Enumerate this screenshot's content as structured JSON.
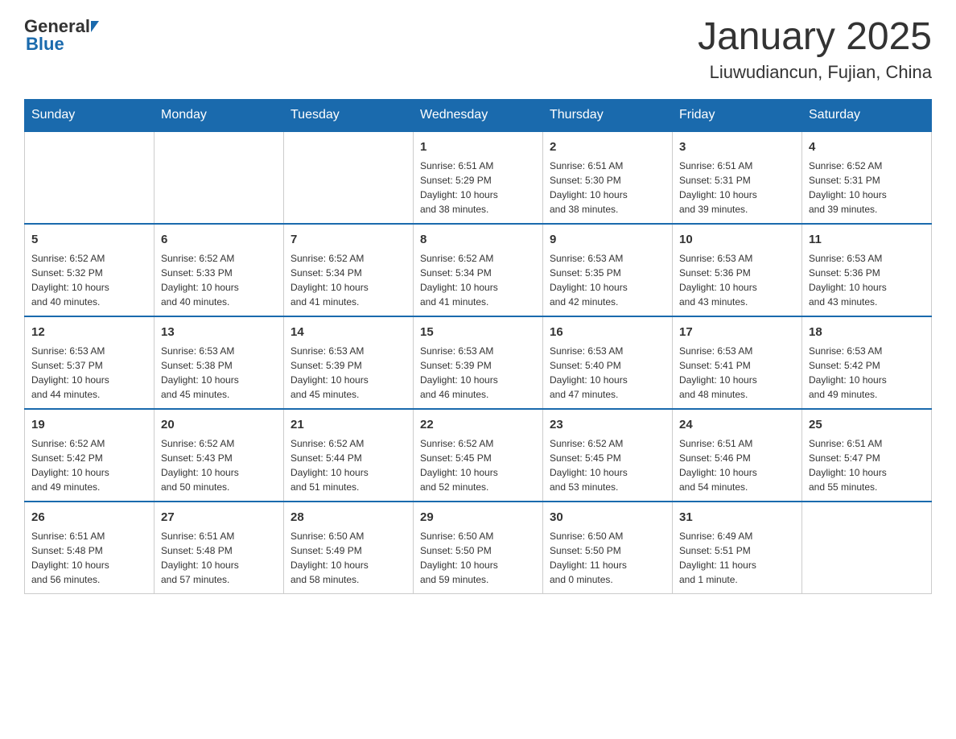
{
  "header": {
    "logo_general": "General",
    "logo_blue": "Blue",
    "title": "January 2025",
    "subtitle": "Liuwudiancun, Fujian, China"
  },
  "days_of_week": [
    "Sunday",
    "Monday",
    "Tuesday",
    "Wednesday",
    "Thursday",
    "Friday",
    "Saturday"
  ],
  "weeks": [
    [
      {
        "day": "",
        "info": ""
      },
      {
        "day": "",
        "info": ""
      },
      {
        "day": "",
        "info": ""
      },
      {
        "day": "1",
        "info": "Sunrise: 6:51 AM\nSunset: 5:29 PM\nDaylight: 10 hours\nand 38 minutes."
      },
      {
        "day": "2",
        "info": "Sunrise: 6:51 AM\nSunset: 5:30 PM\nDaylight: 10 hours\nand 38 minutes."
      },
      {
        "day": "3",
        "info": "Sunrise: 6:51 AM\nSunset: 5:31 PM\nDaylight: 10 hours\nand 39 minutes."
      },
      {
        "day": "4",
        "info": "Sunrise: 6:52 AM\nSunset: 5:31 PM\nDaylight: 10 hours\nand 39 minutes."
      }
    ],
    [
      {
        "day": "5",
        "info": "Sunrise: 6:52 AM\nSunset: 5:32 PM\nDaylight: 10 hours\nand 40 minutes."
      },
      {
        "day": "6",
        "info": "Sunrise: 6:52 AM\nSunset: 5:33 PM\nDaylight: 10 hours\nand 40 minutes."
      },
      {
        "day": "7",
        "info": "Sunrise: 6:52 AM\nSunset: 5:34 PM\nDaylight: 10 hours\nand 41 minutes."
      },
      {
        "day": "8",
        "info": "Sunrise: 6:52 AM\nSunset: 5:34 PM\nDaylight: 10 hours\nand 41 minutes."
      },
      {
        "day": "9",
        "info": "Sunrise: 6:53 AM\nSunset: 5:35 PM\nDaylight: 10 hours\nand 42 minutes."
      },
      {
        "day": "10",
        "info": "Sunrise: 6:53 AM\nSunset: 5:36 PM\nDaylight: 10 hours\nand 43 minutes."
      },
      {
        "day": "11",
        "info": "Sunrise: 6:53 AM\nSunset: 5:36 PM\nDaylight: 10 hours\nand 43 minutes."
      }
    ],
    [
      {
        "day": "12",
        "info": "Sunrise: 6:53 AM\nSunset: 5:37 PM\nDaylight: 10 hours\nand 44 minutes."
      },
      {
        "day": "13",
        "info": "Sunrise: 6:53 AM\nSunset: 5:38 PM\nDaylight: 10 hours\nand 45 minutes."
      },
      {
        "day": "14",
        "info": "Sunrise: 6:53 AM\nSunset: 5:39 PM\nDaylight: 10 hours\nand 45 minutes."
      },
      {
        "day": "15",
        "info": "Sunrise: 6:53 AM\nSunset: 5:39 PM\nDaylight: 10 hours\nand 46 minutes."
      },
      {
        "day": "16",
        "info": "Sunrise: 6:53 AM\nSunset: 5:40 PM\nDaylight: 10 hours\nand 47 minutes."
      },
      {
        "day": "17",
        "info": "Sunrise: 6:53 AM\nSunset: 5:41 PM\nDaylight: 10 hours\nand 48 minutes."
      },
      {
        "day": "18",
        "info": "Sunrise: 6:53 AM\nSunset: 5:42 PM\nDaylight: 10 hours\nand 49 minutes."
      }
    ],
    [
      {
        "day": "19",
        "info": "Sunrise: 6:52 AM\nSunset: 5:42 PM\nDaylight: 10 hours\nand 49 minutes."
      },
      {
        "day": "20",
        "info": "Sunrise: 6:52 AM\nSunset: 5:43 PM\nDaylight: 10 hours\nand 50 minutes."
      },
      {
        "day": "21",
        "info": "Sunrise: 6:52 AM\nSunset: 5:44 PM\nDaylight: 10 hours\nand 51 minutes."
      },
      {
        "day": "22",
        "info": "Sunrise: 6:52 AM\nSunset: 5:45 PM\nDaylight: 10 hours\nand 52 minutes."
      },
      {
        "day": "23",
        "info": "Sunrise: 6:52 AM\nSunset: 5:45 PM\nDaylight: 10 hours\nand 53 minutes."
      },
      {
        "day": "24",
        "info": "Sunrise: 6:51 AM\nSunset: 5:46 PM\nDaylight: 10 hours\nand 54 minutes."
      },
      {
        "day": "25",
        "info": "Sunrise: 6:51 AM\nSunset: 5:47 PM\nDaylight: 10 hours\nand 55 minutes."
      }
    ],
    [
      {
        "day": "26",
        "info": "Sunrise: 6:51 AM\nSunset: 5:48 PM\nDaylight: 10 hours\nand 56 minutes."
      },
      {
        "day": "27",
        "info": "Sunrise: 6:51 AM\nSunset: 5:48 PM\nDaylight: 10 hours\nand 57 minutes."
      },
      {
        "day": "28",
        "info": "Sunrise: 6:50 AM\nSunset: 5:49 PM\nDaylight: 10 hours\nand 58 minutes."
      },
      {
        "day": "29",
        "info": "Sunrise: 6:50 AM\nSunset: 5:50 PM\nDaylight: 10 hours\nand 59 minutes."
      },
      {
        "day": "30",
        "info": "Sunrise: 6:50 AM\nSunset: 5:50 PM\nDaylight: 11 hours\nand 0 minutes."
      },
      {
        "day": "31",
        "info": "Sunrise: 6:49 AM\nSunset: 5:51 PM\nDaylight: 11 hours\nand 1 minute."
      },
      {
        "day": "",
        "info": ""
      }
    ]
  ]
}
